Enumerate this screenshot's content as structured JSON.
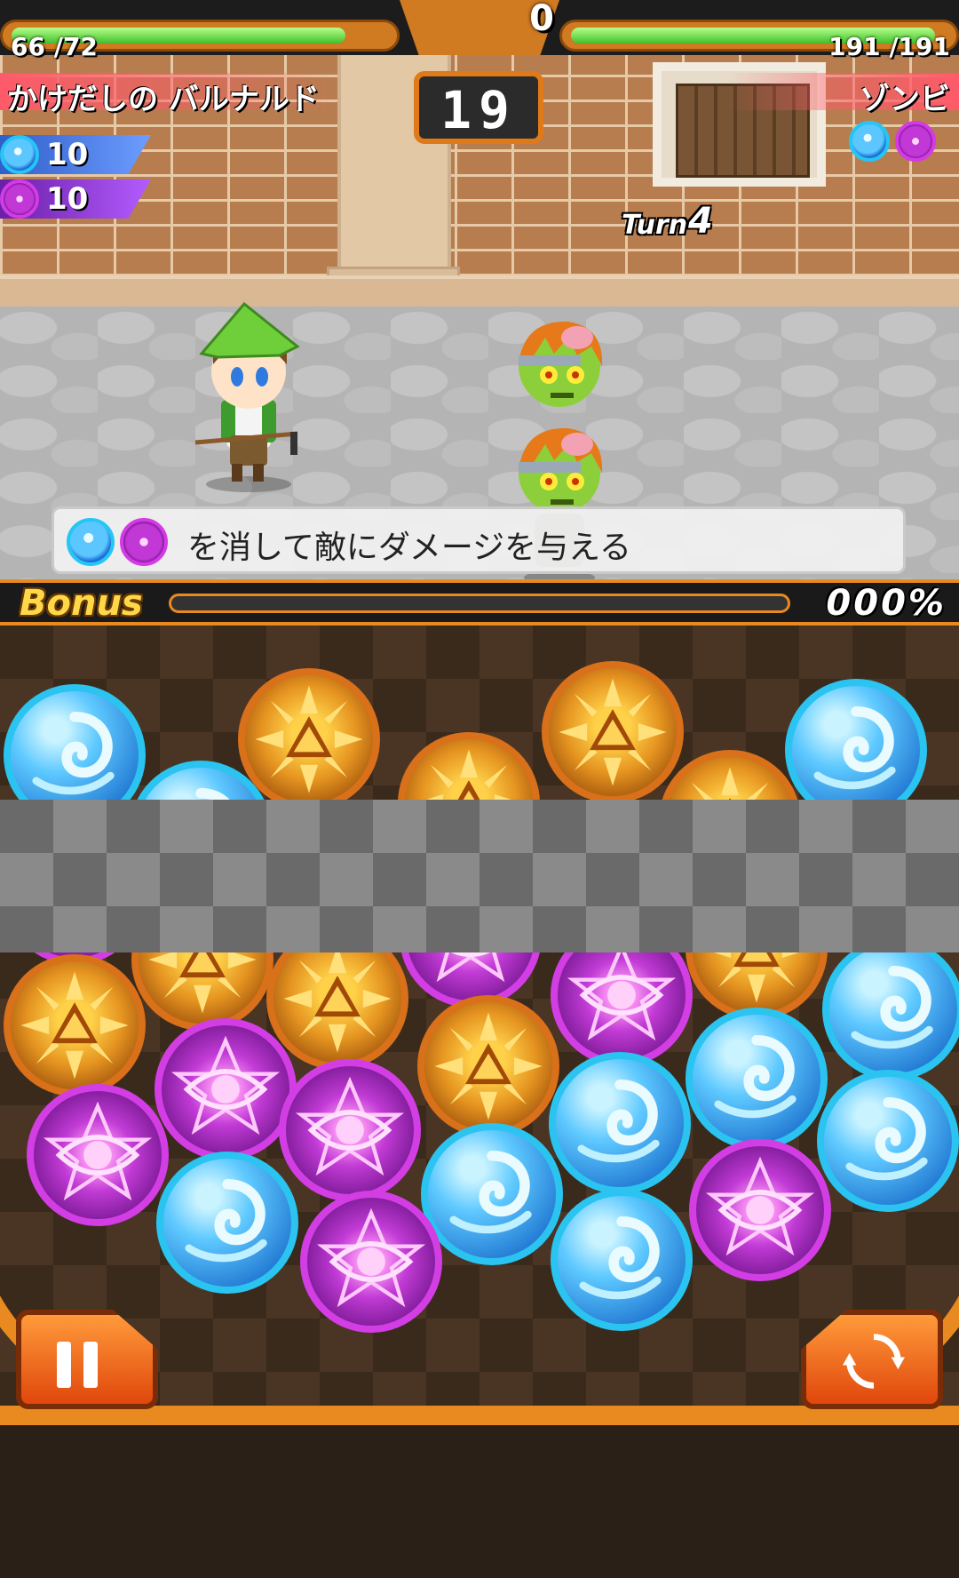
{
  "hud": {
    "player_hp": "66 /72",
    "enemy_hp": "191 /191",
    "score": "0",
    "timer": "19",
    "turn_label": "Turn",
    "turn_number": "4",
    "player_hp_fraction": 0.917,
    "enemy_hp_fraction": 1.0
  },
  "player": {
    "name": "かけだしの バルナルド",
    "resources": [
      {
        "icon": "water-orb-icon",
        "count": "10"
      },
      {
        "icon": "eye-orb-icon",
        "count": "10"
      }
    ]
  },
  "enemy": {
    "name": "ゾンビ",
    "weakness_icons": [
      "water-orb-icon",
      "eye-orb-icon"
    ]
  },
  "message": {
    "text": "を消して敵にダメージを与える",
    "icons": [
      "water-orb-icon",
      "eye-orb-icon"
    ]
  },
  "bonus": {
    "label": "Bonus",
    "percent": "000%",
    "fill_fraction": 0.0
  },
  "board": {
    "orbs": [
      {
        "type": "water"
      },
      {
        "type": "water"
      },
      {
        "type": "sun"
      },
      {
        "type": "sun"
      },
      {
        "type": "sun"
      },
      {
        "type": "sun"
      },
      {
        "type": "water"
      },
      {
        "type": "eye"
      },
      {
        "type": "eye"
      },
      {
        "type": "water"
      },
      {
        "type": "sun"
      },
      {
        "type": "sun"
      },
      {
        "type": "sun"
      },
      {
        "type": "eye"
      },
      {
        "type": "eye"
      },
      {
        "type": "sun"
      },
      {
        "type": "water"
      },
      {
        "type": "sun"
      },
      {
        "type": "eye"
      },
      {
        "type": "sun"
      },
      {
        "type": "water"
      },
      {
        "type": "eye"
      },
      {
        "type": "eye"
      },
      {
        "type": "water"
      },
      {
        "type": "water"
      },
      {
        "type": "water"
      },
      {
        "type": "water"
      },
      {
        "type": "eye"
      },
      {
        "type": "water"
      },
      {
        "type": "eye"
      }
    ]
  },
  "colors": {
    "accent_orange": "#e98a20",
    "hp_green": "#3fbf2c",
    "water": "#2bc4f0",
    "eye": "#d23ee4",
    "sun": "#d9701a"
  }
}
